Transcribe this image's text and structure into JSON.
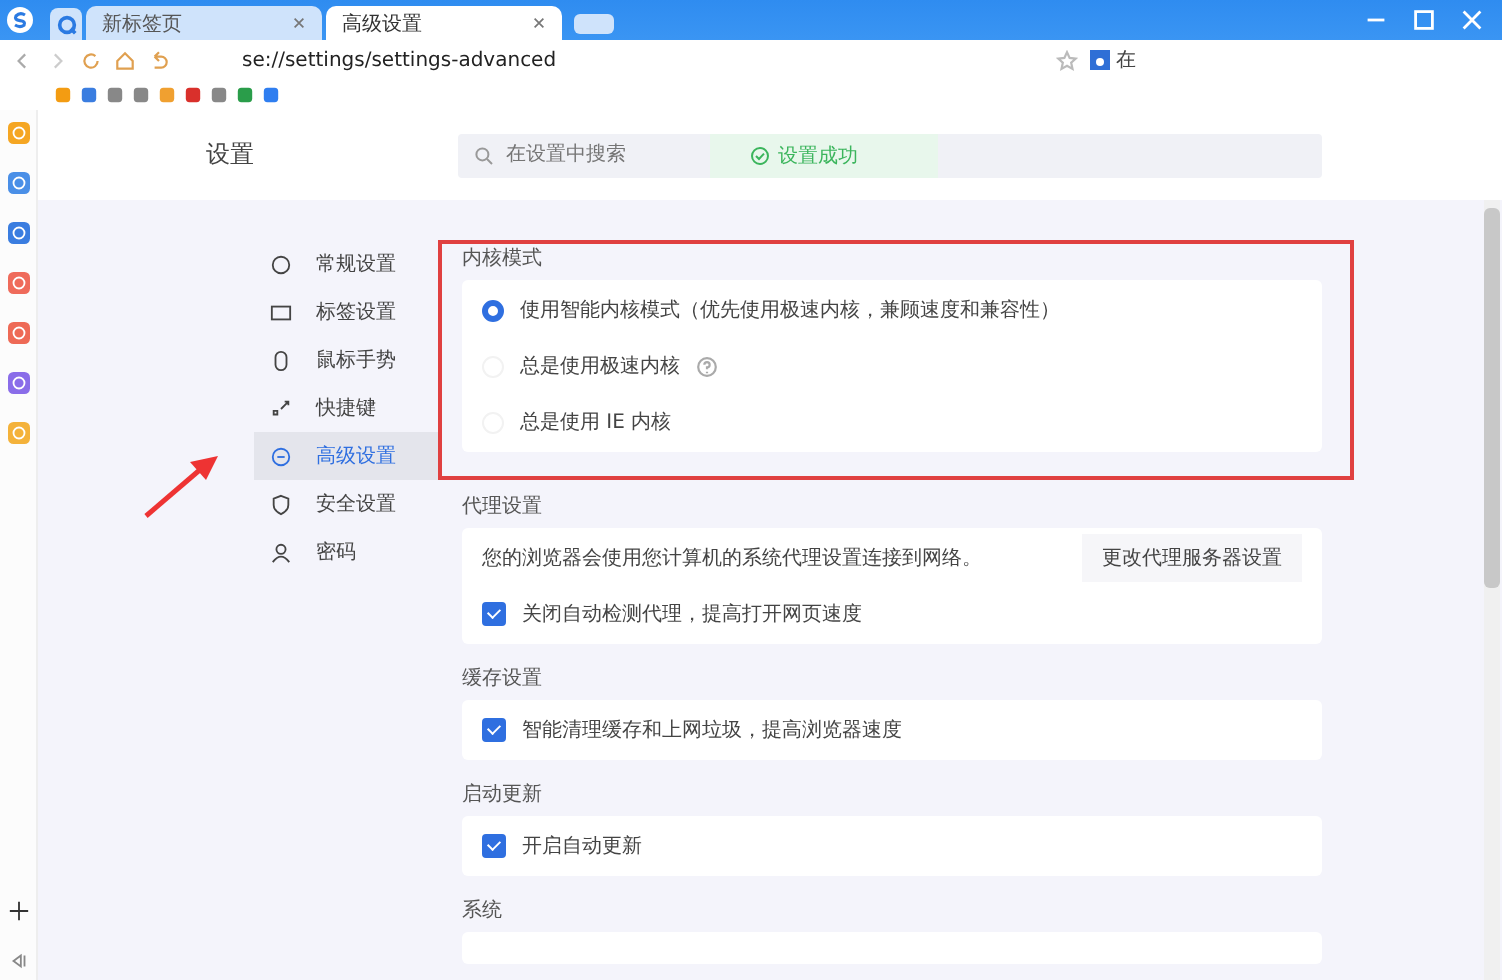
{
  "browser": {
    "tabs": [
      {
        "label": "新标签页",
        "selected": false
      },
      {
        "label": "高级设置",
        "selected": true
      }
    ],
    "address": "se://settings/settings-advanced",
    "search_text": "在"
  },
  "settings": {
    "title": "设置",
    "search": {
      "placeholder": "在设置中搜索"
    },
    "toast": "设置成功",
    "nav": [
      {
        "label": "常规设置",
        "selected": false
      },
      {
        "label": "标签设置",
        "selected": false
      },
      {
        "label": "鼠标手势",
        "selected": false
      },
      {
        "label": "快捷键",
        "selected": false
      },
      {
        "label": "高级设置",
        "selected": true
      },
      {
        "label": "安全设置",
        "selected": false
      },
      {
        "label": "密码",
        "selected": false
      }
    ],
    "sections": [
      {
        "title": "内核模式",
        "highlighted": true,
        "rows": [
          {
            "kind": "radio",
            "label": "使用智能内核模式（优先使用极速内核，兼顾速度和兼容性）",
            "selected": true
          },
          {
            "kind": "radio",
            "label": "总是使用极速内核",
            "selected": false,
            "help": true
          },
          {
            "kind": "radio",
            "label": "总是使用 IE 内核",
            "selected": false
          }
        ]
      },
      {
        "title": "代理设置",
        "highlighted": false,
        "rows": [
          {
            "kind": "info",
            "text": "您的浏览器会使用您计算机的系统代理设置连接到网络。",
            "button": "更改代理服务器设置"
          },
          {
            "kind": "checkbox",
            "label": "关闭自动检测代理，提高打开网页速度",
            "checked": true
          }
        ]
      },
      {
        "title": "缓存设置",
        "highlighted": false,
        "rows": [
          {
            "kind": "checkbox",
            "label": "智能清理缓存和上网垃圾，提高浏览器速度",
            "checked": true
          }
        ]
      },
      {
        "title": "启动更新",
        "highlighted": false,
        "rows": [
          {
            "kind": "checkbox",
            "label": "开启自动更新",
            "checked": true
          }
        ]
      },
      {
        "title": "系统",
        "highlighted": false
      }
    ]
  }
}
